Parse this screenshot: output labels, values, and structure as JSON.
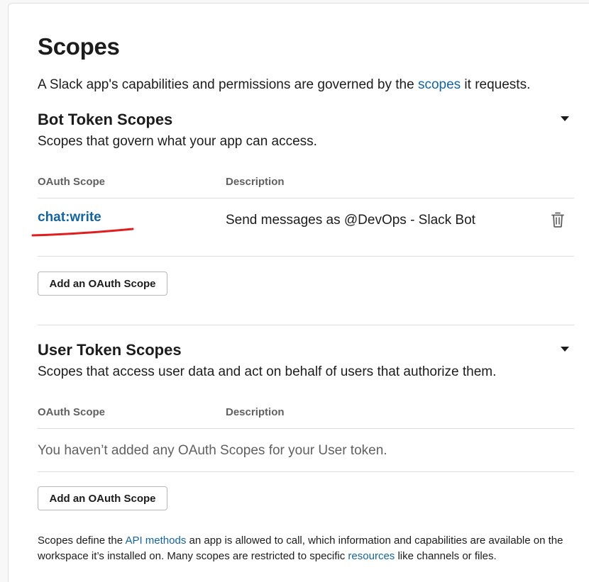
{
  "page": {
    "title": "Scopes",
    "intro_before": "A Slack app's capabilities and permissions are governed by the ",
    "intro_link": "scopes",
    "intro_after": " it requests."
  },
  "bot_section": {
    "title": "Bot Token Scopes",
    "subtitle": "Scopes that govern what your app can access.",
    "col_scope": "OAuth Scope",
    "col_description": "Description",
    "rows": [
      {
        "scope": "chat:write",
        "description": "Send messages as @DevOps - Slack Bot"
      }
    ],
    "add_button": "Add an OAuth Scope"
  },
  "user_section": {
    "title": "User Token Scopes",
    "subtitle": "Scopes that access user data and act on behalf of users that authorize them.",
    "col_scope": "OAuth Scope",
    "col_description": "Description",
    "empty_message": "You haven’t added any OAuth Scopes for your User token.",
    "add_button": "Add an OAuth Scope"
  },
  "footer": {
    "part1": "Scopes define the ",
    "link1": "API methods",
    "part2": " an app is allowed to call, which information and capabilities are available on the workspace it’s installed on. Many scopes are restricted to specific ",
    "link2": "resources",
    "part3": " like channels or files."
  },
  "icons": {
    "trash": "trash-icon",
    "caret": "caret-down-icon"
  },
  "colors": {
    "link": "#1264a3",
    "annotation": "#e01e1e"
  }
}
